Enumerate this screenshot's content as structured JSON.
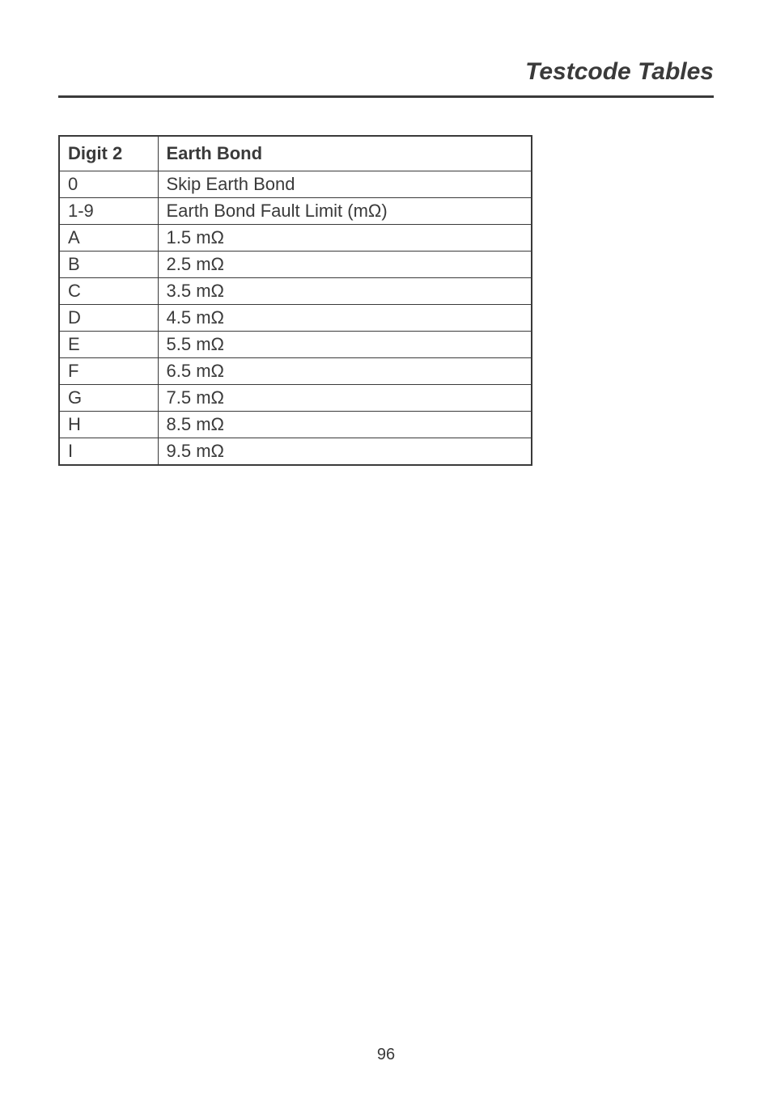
{
  "header": {
    "title": "Testcode Tables"
  },
  "table": {
    "headers": {
      "col1": "Digit 2",
      "col2": "Earth Bond"
    },
    "rows": [
      {
        "c1": "0",
        "c2": "Skip Earth Bond"
      },
      {
        "c1": "1-9",
        "c2": "Earth Bond Fault Limit (mΩ)"
      },
      {
        "c1": "A",
        "c2": "1.5 mΩ"
      },
      {
        "c1": "B",
        "c2": "2.5 mΩ"
      },
      {
        "c1": "C",
        "c2": "3.5 mΩ"
      },
      {
        "c1": "D",
        "c2": "4.5 mΩ"
      },
      {
        "c1": "E",
        "c2": "5.5 mΩ"
      },
      {
        "c1": "F",
        "c2": "6.5 mΩ"
      },
      {
        "c1": "G",
        "c2": "7.5 mΩ"
      },
      {
        "c1": "H",
        "c2": "8.5 mΩ"
      },
      {
        "c1": "I",
        "c2": "9.5 mΩ"
      }
    ]
  },
  "footer": {
    "page_number": "96"
  }
}
